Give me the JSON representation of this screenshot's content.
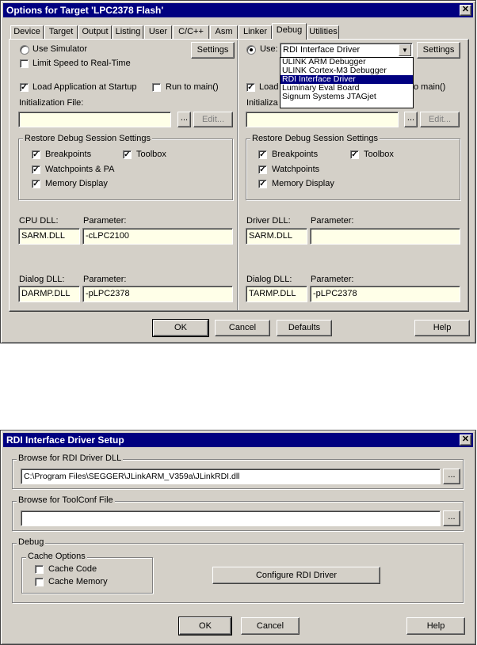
{
  "dialog1": {
    "title": "Options for Target 'LPC2378 Flash'",
    "close_glyph": "✕",
    "tabs": [
      "Device",
      "Target",
      "Output",
      "Listing",
      "User",
      "C/C++",
      "Asm",
      "Linker",
      "Debug",
      "Utilities"
    ],
    "active_tab": "Debug",
    "left": {
      "use_simulator": "Use Simulator",
      "limit_speed": "Limit Speed to Real-Time",
      "settings": "Settings",
      "load_app": "Load Application at Startup",
      "run_to_main": "Run to main()",
      "init_file": "Initialization File:",
      "init_value": "",
      "browse": "...",
      "edit": "Edit...",
      "restore": "Restore Debug Session Settings",
      "breakpoints": "Breakpoints",
      "toolbox": "Toolbox",
      "watchpoints": "Watchpoints & PA",
      "memory_display": "Memory Display",
      "cpu_dll_label": "CPU DLL:",
      "parameter_label": "Parameter:",
      "cpu_dll": "SARM.DLL",
      "cpu_param": "-cLPC2100",
      "dialog_dll_label": "Dialog DLL:",
      "dialog_param_label": "Parameter:",
      "dialog_dll": "DARMP.DLL",
      "dialog_param": "-pLPC2378"
    },
    "right": {
      "use": "Use:",
      "selected_driver": "RDI Interface Driver",
      "settings": "Settings",
      "driver_options": [
        "ULINK ARM Debugger",
        "ULINK Cortex-M3 Debugger",
        "RDI Interface Driver",
        "Luminary Eval Board",
        "Signum Systems JTAGjet"
      ],
      "load": "Load",
      "main_suffix": "o main()",
      "init_file_partial": "Initializa",
      "init_value": "",
      "browse": "...",
      "edit": "Edit...",
      "restore": "Restore Debug Session Settings",
      "breakpoints": "Breakpoints",
      "toolbox": "Toolbox",
      "watchpoints": "Watchpoints",
      "memory_display": "Memory Display",
      "driver_dll_label": "Driver DLL:",
      "parameter_label": "Parameter:",
      "driver_dll": "SARM.DLL",
      "driver_param": "",
      "dialog_dll_label": "Dialog DLL:",
      "dialog_param_label": "Parameter:",
      "dialog_dll": "TARMP.DLL",
      "dialog_param": "-pLPC2378"
    },
    "buttons": {
      "ok": "OK",
      "cancel": "Cancel",
      "defaults": "Defaults",
      "help": "Help"
    }
  },
  "dialog2": {
    "title": "RDI Interface Driver Setup",
    "close_glyph": "✕",
    "browse_dll_group": "Browse for RDI Driver DLL",
    "dll_path": "C:\\Program Files\\SEGGER\\JLinkARM_V359a\\JLinkRDI.dll",
    "browse": "...",
    "toolconf_group": "Browse for ToolConf File",
    "toolconf_path": "",
    "debug_group": "Debug",
    "cache_options": "Cache Options",
    "cache_code": "Cache Code",
    "cache_memory": "Cache Memory",
    "configure": "Configure RDI Driver",
    "ok": "OK",
    "cancel": "Cancel",
    "help": "Help"
  }
}
